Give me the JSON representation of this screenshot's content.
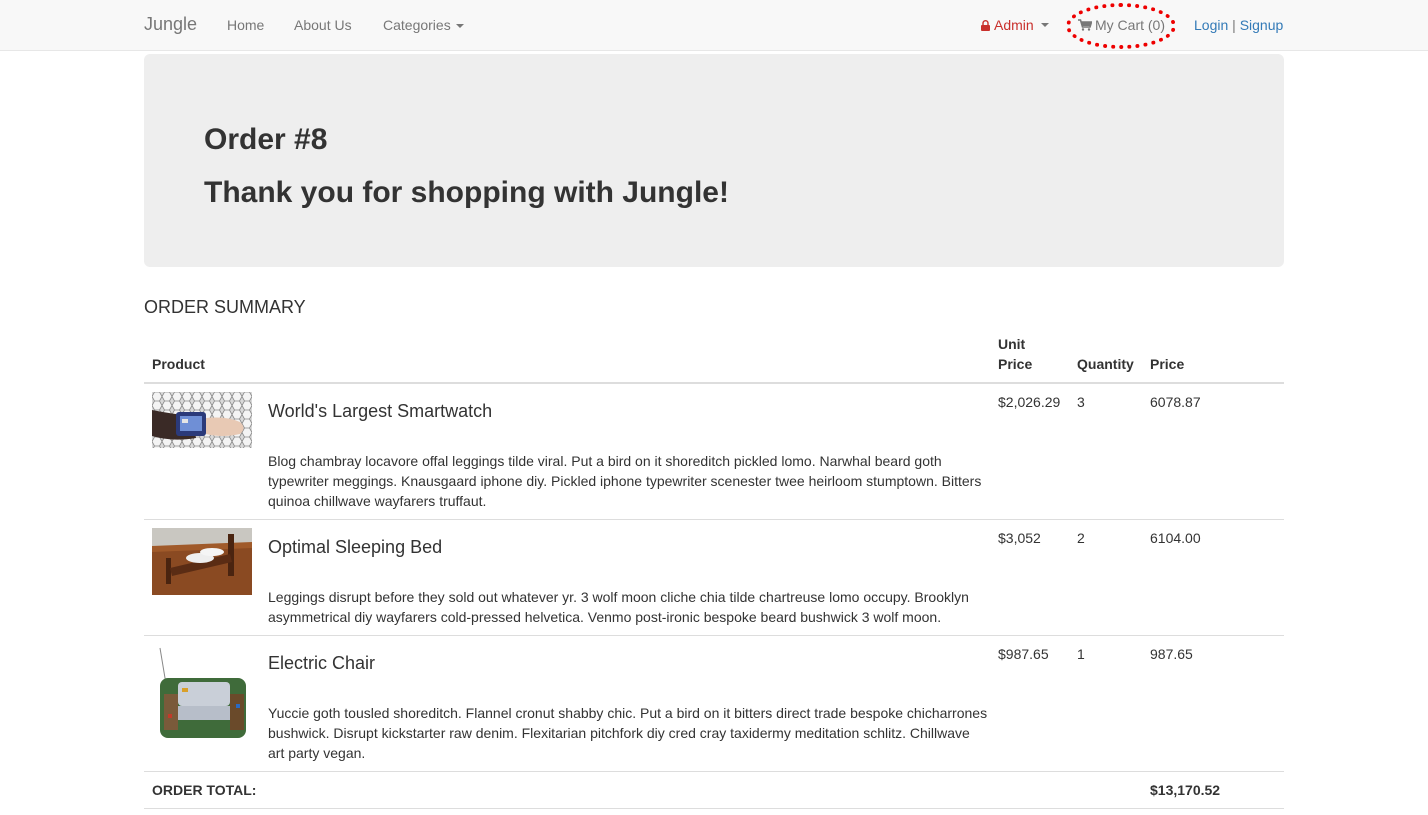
{
  "nav": {
    "brand": "Jungle",
    "home": "Home",
    "about": "About Us",
    "categories": "Categories",
    "admin": "Admin",
    "cart": "My Cart (0)",
    "login": "Login",
    "separator": "|",
    "signup": "Signup"
  },
  "jumbotron": {
    "order_title": "Order #8",
    "thanks": "Thank you for shopping with Jungle!"
  },
  "summary": {
    "title": "ORDER SUMMARY",
    "headers": {
      "product": "Product",
      "unit_price_1": "Unit",
      "unit_price_2": "Price",
      "quantity": "Quantity",
      "price": "Price"
    },
    "items": [
      {
        "name": "World's Largest Smartwatch",
        "description": "Blog chambray locavore offal leggings tilde viral. Put a bird on it shoreditch pickled lomo. Narwhal beard goth typewriter meggings. Knausgaard iphone diy. Pickled iphone typewriter scenester twee heirloom stumptown. Bitters quinoa chillwave wayfarers truffaut.",
        "unit_price": "$2,026.29",
        "quantity": "3",
        "price": "6078.87"
      },
      {
        "name": "Optimal Sleeping Bed",
        "description": "Leggings disrupt before they sold out whatever yr. 3 wolf moon cliche chia tilde chartreuse lomo occupy. Brooklyn asymmetrical diy wayfarers cold-pressed helvetica. Venmo post-ironic bespoke beard bushwick 3 wolf moon.",
        "unit_price": "$3,052",
        "quantity": "2",
        "price": "6104.00"
      },
      {
        "name": "Electric Chair",
        "description": "Yuccie goth tousled shoreditch. Flannel cronut shabby chic. Put a bird on it bitters direct trade bespoke chicharrones bushwick. Disrupt kickstarter raw denim. Flexitarian pitchfork diy cred cray taxidermy meditation schlitz. Chillwave art party vegan.",
        "unit_price": "$987.65",
        "quantity": "1",
        "price": "987.65"
      }
    ],
    "total_label": "ORDER TOTAL:",
    "total_value": "$13,170.52"
  },
  "colors": {
    "link": "#337ab7",
    "admin": "#c9302c",
    "highlight_circle": "#ee0000"
  }
}
